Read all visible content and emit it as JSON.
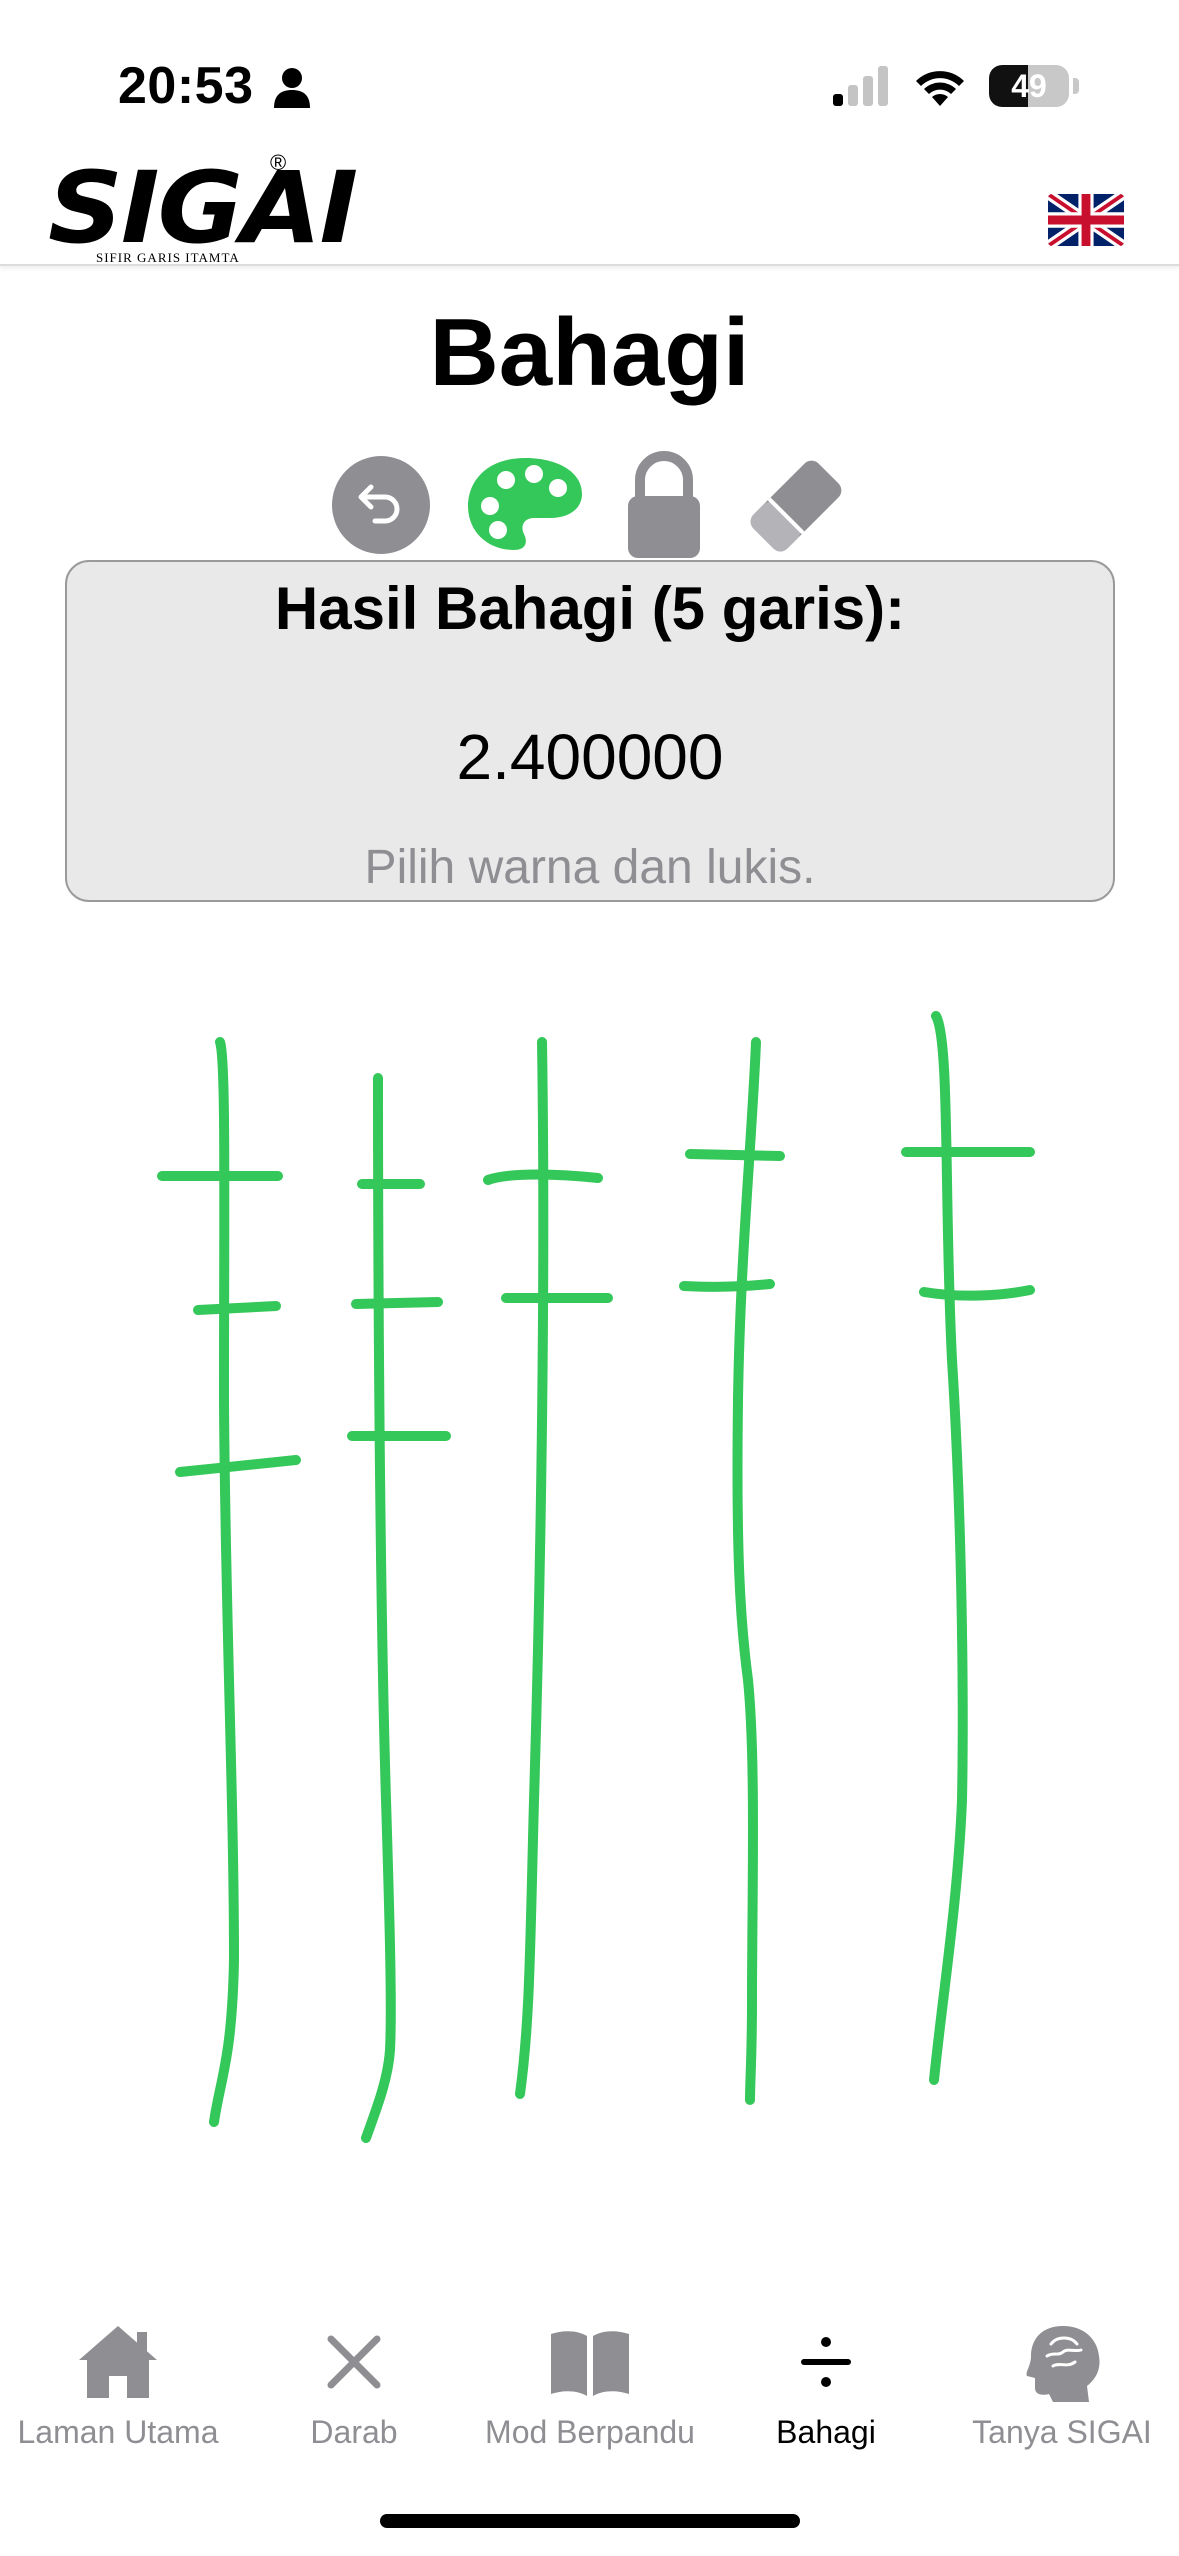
{
  "status_bar": {
    "time": "20:53",
    "battery": "49",
    "battery_level": 0.49,
    "icons": [
      "person-icon",
      "signal-icon",
      "wifi-icon",
      "battery-icon"
    ]
  },
  "header": {
    "logo_text": "SIGAI",
    "logo_registered": "®",
    "logo_subtitle": "SIFIR GARIS ITAMTA",
    "language_flag": "uk-flag-icon"
  },
  "page": {
    "title": "Bahagi"
  },
  "toolbar": {
    "icons": [
      "undo-icon",
      "palette-icon",
      "lock-icon",
      "eraser-icon"
    ],
    "active_color": "#34c759",
    "inactive_color": "#8e8e93"
  },
  "result": {
    "title": "Hasil Bahagi (5 garis):",
    "value": "2.400000",
    "hint": "Pilih warna dan lukis."
  },
  "drawing": {
    "stroke_color": "#34c759",
    "vertical_lines": 5,
    "ticks_per_line": [
      3,
      3,
      2,
      2,
      2
    ]
  },
  "tab_bar": {
    "tabs": [
      {
        "label": "Laman Utama",
        "icon": "home-icon",
        "active": false
      },
      {
        "label": "Darab",
        "icon": "multiply-icon",
        "active": false
      },
      {
        "label": "Mod Berpandu",
        "icon": "book-icon",
        "active": false
      },
      {
        "label": "Bahagi",
        "icon": "divide-icon",
        "active": true
      },
      {
        "label": "Tanya SIGAI",
        "icon": "brain-head-icon",
        "active": false
      }
    ]
  }
}
